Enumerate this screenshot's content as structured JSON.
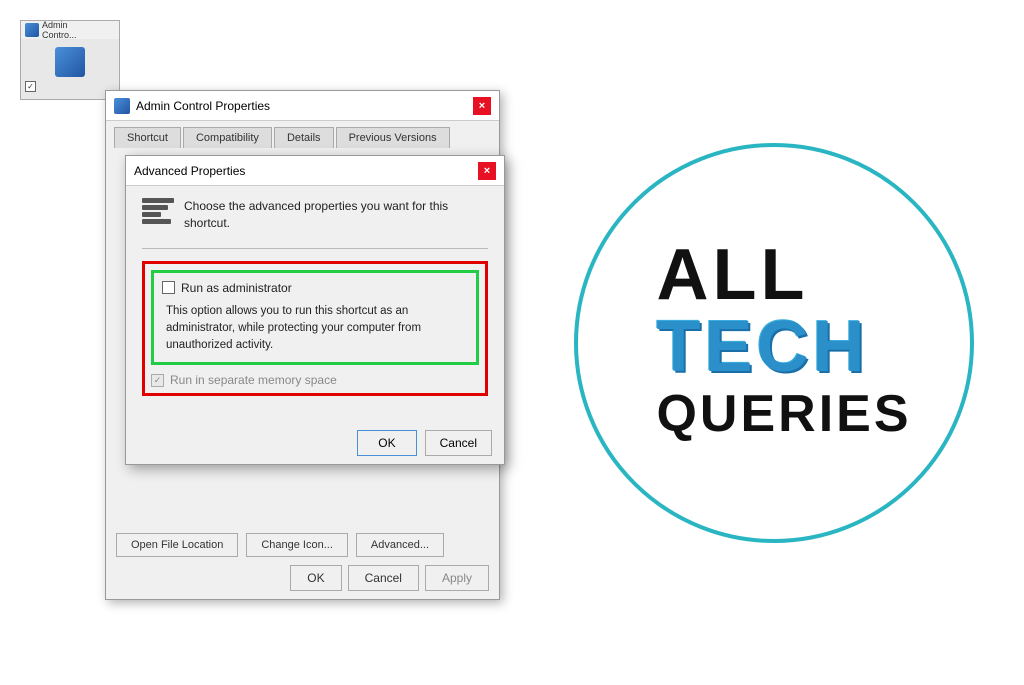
{
  "background": {
    "color": "#ffffff"
  },
  "logo": {
    "all_text": "ALL",
    "tech_text": "TECH",
    "queries_text": "QUERIES"
  },
  "bg_window": {
    "title": "Admin\nControl",
    "icon_alt": "admin-icon"
  },
  "outer_dialog": {
    "title": "Admin Control Properties",
    "close_label": "×",
    "tabs": [
      "Shortcut",
      "Compatibility",
      "Details",
      "Previous Versions"
    ],
    "active_tab_index": 0,
    "footer_buttons": {
      "open_file_location": "Open File Location",
      "change_icon": "Change Icon...",
      "advanced": "Advanced..."
    },
    "bottom_buttons": {
      "ok": "OK",
      "cancel": "Cancel",
      "apply": "Apply"
    }
  },
  "inner_dialog": {
    "title": "Advanced Properties",
    "close_label": "×",
    "header_description": "Choose the advanced properties you want for this shortcut.",
    "run_as_admin_label": "Run as administrator",
    "run_as_admin_description": "This option allows you to run this shortcut as an administrator, while protecting your computer from unauthorized activity.",
    "run_separate_memory_label": "Run in separate memory space",
    "buttons": {
      "ok": "OK",
      "cancel": "Cancel"
    }
  },
  "highlight_colors": {
    "red": "#e00000",
    "green": "#22cc44"
  }
}
